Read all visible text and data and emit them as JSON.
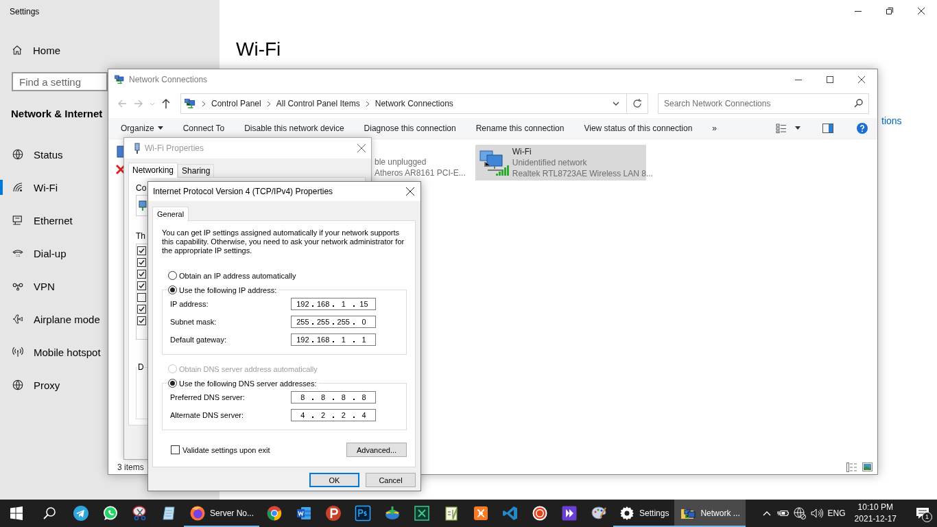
{
  "settings": {
    "title": "Settings",
    "home": "Home",
    "search": {
      "placeholder": "Find a setting"
    },
    "section": "Network & Internet",
    "nav": [
      {
        "kind": "status",
        "label": "Status",
        "selected": false
      },
      {
        "kind": "wifi",
        "label": "Wi-Fi",
        "selected": true
      },
      {
        "kind": "ethernet",
        "label": "Ethernet",
        "selected": false
      },
      {
        "kind": "dialup",
        "label": "Dial-up",
        "selected": false
      },
      {
        "kind": "vpn",
        "label": "VPN",
        "selected": false
      },
      {
        "kind": "airplane",
        "label": "Airplane mode",
        "selected": false
      },
      {
        "kind": "hotspot",
        "label": "Mobile hotspot",
        "selected": false
      },
      {
        "kind": "proxy",
        "label": "Proxy",
        "selected": false
      }
    ],
    "page_title": "Wi-Fi",
    "link_fragment": "tions"
  },
  "network_connections": {
    "title": "Network Connections",
    "breadcrumb": [
      "Control Panel",
      "All Control Panel Items",
      "Network Connections"
    ],
    "search": {
      "placeholder": "Search Network Connections"
    },
    "toolbar": [
      {
        "label": "Organize",
        "menu": true
      },
      {
        "label": "Connect To",
        "menu": false
      },
      {
        "label": "Disable this network device",
        "menu": false
      },
      {
        "label": "Diagnose this connection",
        "menu": false
      },
      {
        "label": "Rename this connection",
        "menu": false
      },
      {
        "label": "View status of this connection",
        "menu": false
      }
    ],
    "overflow": "»",
    "connections": [
      {
        "kind": "ethernet",
        "lines": [
          "ble unplugged",
          "Atheros AR8161 PCI-E..."
        ],
        "selected": false
      },
      {
        "kind": "wifi",
        "name": "Wi-Fi",
        "lines": [
          "Unidentified network",
          "Realtek RTL8723AE Wireless LAN 8..."
        ],
        "selected": true
      }
    ],
    "status": "3 items"
  },
  "wifi_properties": {
    "title": "Wi-Fi Properties",
    "tabs": [
      {
        "label": "Networking",
        "selected": true
      },
      {
        "label": "Sharing",
        "selected": false
      }
    ],
    "connect_label": "Co",
    "components_label": "Th",
    "components": [
      {
        "checked": true
      },
      {
        "checked": true
      },
      {
        "checked": true
      },
      {
        "checked": true
      },
      {
        "checked": false
      },
      {
        "checked": true
      },
      {
        "checked": true
      }
    ],
    "group_label": "D"
  },
  "ipv4_dialog": {
    "title": "Internet Protocol Version 4 (TCP/IPv4) Properties",
    "tabs": [
      {
        "label": "General",
        "selected": true
      }
    ],
    "description": "You can get IP settings assigned automatically if your network supports this capability. Otherwise, you need to ask your network administrator for the appropriate IP settings.",
    "ip_options": [
      {
        "label": "Obtain an IP address automatically",
        "selected": false,
        "disabled": false
      },
      {
        "label": "Use the following IP address:",
        "selected": true,
        "disabled": false
      }
    ],
    "ip_fields": [
      {
        "label": "IP address:",
        "octets": [
          "192",
          "168",
          "1",
          "15"
        ]
      },
      {
        "label": "Subnet mask:",
        "octets": [
          "255",
          "255",
          "255",
          "0"
        ]
      },
      {
        "label": "Default gateway:",
        "octets": [
          "192",
          "168",
          "1",
          "1"
        ]
      }
    ],
    "dns_options": [
      {
        "label": "Obtain DNS server address automatically",
        "selected": false,
        "disabled": true
      },
      {
        "label": "Use the following DNS server addresses:",
        "selected": true,
        "disabled": false
      }
    ],
    "dns_fields": [
      {
        "label": "Preferred DNS server:",
        "octets": [
          "8",
          "8",
          "8",
          "8"
        ]
      },
      {
        "label": "Alternate DNS server:",
        "octets": [
          "4",
          "2",
          "2",
          "4"
        ]
      }
    ],
    "validate": {
      "label": "Validate settings upon exit",
      "checked": false
    },
    "advanced_button": "Advanced...",
    "ok_button": "OK",
    "cancel_button": "Cancel"
  },
  "taskbar": {
    "apps": [
      {
        "kind": "start",
        "running": false,
        "selected": false
      },
      {
        "kind": "search",
        "running": false,
        "selected": false
      },
      {
        "kind": "telegram",
        "running": false,
        "selected": false
      },
      {
        "kind": "whatsapp",
        "running": false,
        "selected": false
      },
      {
        "kind": "snip",
        "running": false,
        "selected": false
      },
      {
        "kind": "notepad",
        "running": false,
        "selected": false
      },
      {
        "kind": "firefox",
        "label": "Server No...",
        "running": true,
        "selected": false
      },
      {
        "kind": "chrome",
        "running": false,
        "selected": false
      },
      {
        "kind": "word",
        "running": false,
        "selected": false
      },
      {
        "kind": "psiphon",
        "running": false,
        "selected": false
      },
      {
        "kind": "photoshop",
        "running": false,
        "selected": false
      },
      {
        "kind": "idm",
        "running": false,
        "selected": false
      },
      {
        "kind": "xmind",
        "running": false,
        "selected": false
      },
      {
        "kind": "notepadpp",
        "running": false,
        "selected": false
      },
      {
        "kind": "xampp",
        "running": false,
        "selected": false
      },
      {
        "kind": "vscode",
        "running": false,
        "selected": false
      },
      {
        "kind": "recorder",
        "running": false,
        "selected": false
      },
      {
        "kind": "video",
        "running": false,
        "selected": false
      },
      {
        "kind": "paint",
        "running": false,
        "selected": false
      },
      {
        "kind": "settings",
        "label": "Settings",
        "running": true,
        "selected": false
      },
      {
        "kind": "network",
        "label": "Network ...",
        "running": true,
        "selected": true
      }
    ],
    "language": "ENG",
    "time": "10:10 PM",
    "date": "2021-12-17",
    "notification_count": "1"
  }
}
